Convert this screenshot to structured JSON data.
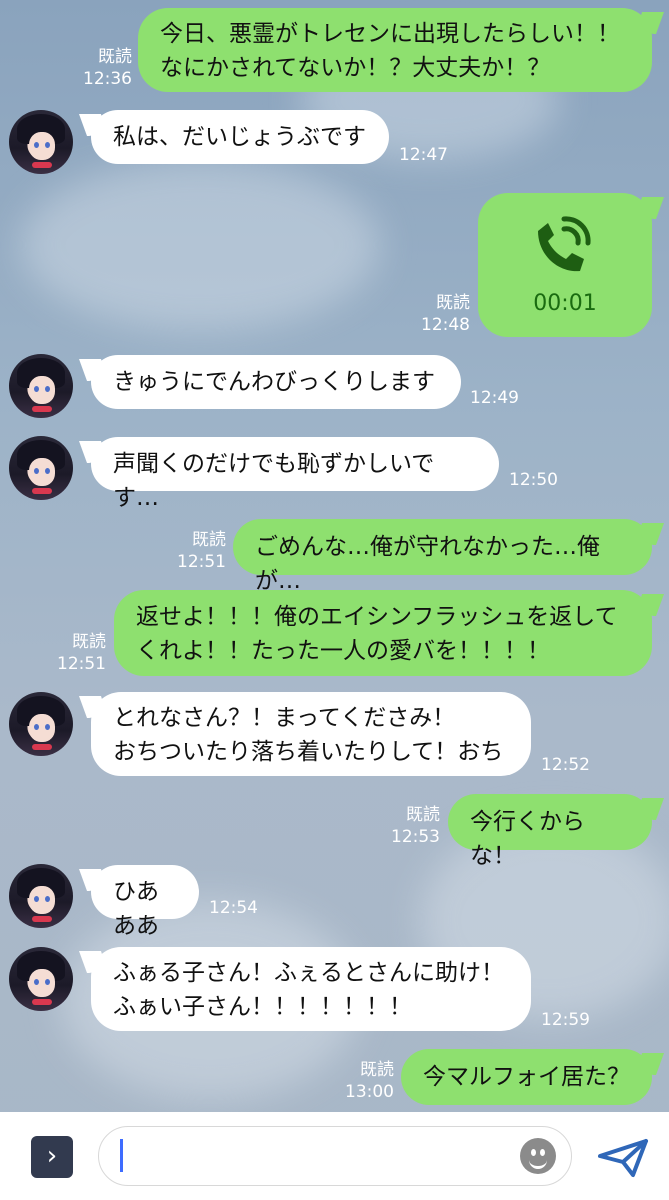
{
  "messages": [
    {
      "dir": "out",
      "read": "既読",
      "time": "12:36",
      "text": "今日、悪霊がトレセンに出現したらしい！！\nなにかされてないか！？大丈夫か！？"
    },
    {
      "dir": "in",
      "time": "12:47",
      "text": "私は、だいじょうぶです"
    },
    {
      "dir": "out",
      "read": "既読",
      "time": "12:48",
      "type": "call",
      "duration": "00:01",
      "icon": "phone-call-icon"
    },
    {
      "dir": "in",
      "time": "12:49",
      "text": "きゅうにでんわびっくりします"
    },
    {
      "dir": "in",
      "time": "12:50",
      "text": "声聞くのだけでも恥ずかしいです…"
    },
    {
      "dir": "out",
      "read": "既読",
      "time": "12:51",
      "text": "ごめんな…俺が守れなかった…俺が…"
    },
    {
      "dir": "out",
      "read": "既読",
      "time": "12:51",
      "text": "返せよ！！！俺のエイシンフラッシュを返して\nくれよ！！たった一人の愛バを！！！！"
    },
    {
      "dir": "in",
      "time": "12:52",
      "text": "とれなさん？！まってくださみ！\nおちついたり落ち着いたりして！おち"
    },
    {
      "dir": "out",
      "read": "既読",
      "time": "12:53",
      "text": "今行くからな！"
    },
    {
      "dir": "in",
      "time": "12:54",
      "text": "ひあああ"
    },
    {
      "dir": "in",
      "time": "12:59",
      "text": "ふぁる子さん！ふぇるとさんに助け！\nふぁい子さん！！！！！！！"
    },
    {
      "dir": "out",
      "read": "既読",
      "time": "13:00",
      "text": "今マルフォイ居た？"
    }
  ],
  "input": {
    "placeholder": "",
    "expand_icon": "chevron-right-icon",
    "emoji_icon": "smiley-icon",
    "send_icon": "send-icon"
  },
  "colors": {
    "outgoing": "#8ee06f",
    "incoming": "#ffffff",
    "call_text": "#1a6b10",
    "background": "#9db3c8"
  }
}
